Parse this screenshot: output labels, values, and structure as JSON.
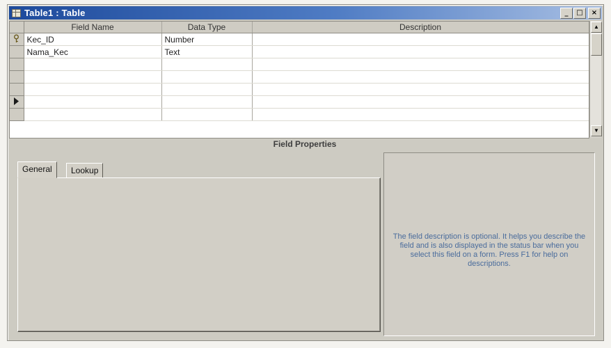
{
  "window": {
    "title": "Table1 : Table",
    "minimize_label": "_",
    "maximize_label": "□",
    "close_label": "×"
  },
  "grid": {
    "headers": [
      "Field Name",
      "Data Type",
      "Description"
    ],
    "rows": [
      {
        "field_name": "Kec_ID",
        "data_type": "Number",
        "description": "",
        "indicator": "primary-key"
      },
      {
        "field_name": "Nama_Kec",
        "data_type": "Text",
        "description": "",
        "indicator": ""
      },
      {
        "field_name": "",
        "data_type": "",
        "description": "",
        "indicator": ""
      },
      {
        "field_name": "",
        "data_type": "",
        "description": "",
        "indicator": ""
      },
      {
        "field_name": "",
        "data_type": "",
        "description": "",
        "indicator": ""
      },
      {
        "field_name": "",
        "data_type": "",
        "description": "",
        "indicator": "current-row"
      },
      {
        "field_name": "",
        "data_type": "",
        "description": "",
        "indicator": ""
      }
    ]
  },
  "field_properties": {
    "header": "Field Properties",
    "tabs": [
      "General",
      "Lookup"
    ],
    "help_text": "The field description is optional.  It helps you describe the field and is also displayed in the status bar when you select this field on a form.  Press F1 for help on descriptions."
  },
  "icons": {
    "table": "table-icon",
    "primary_key": "key-icon",
    "current_row": "row-pointer-icon",
    "scroll_up": "up-arrow-icon",
    "scroll_down": "down-arrow-icon"
  }
}
